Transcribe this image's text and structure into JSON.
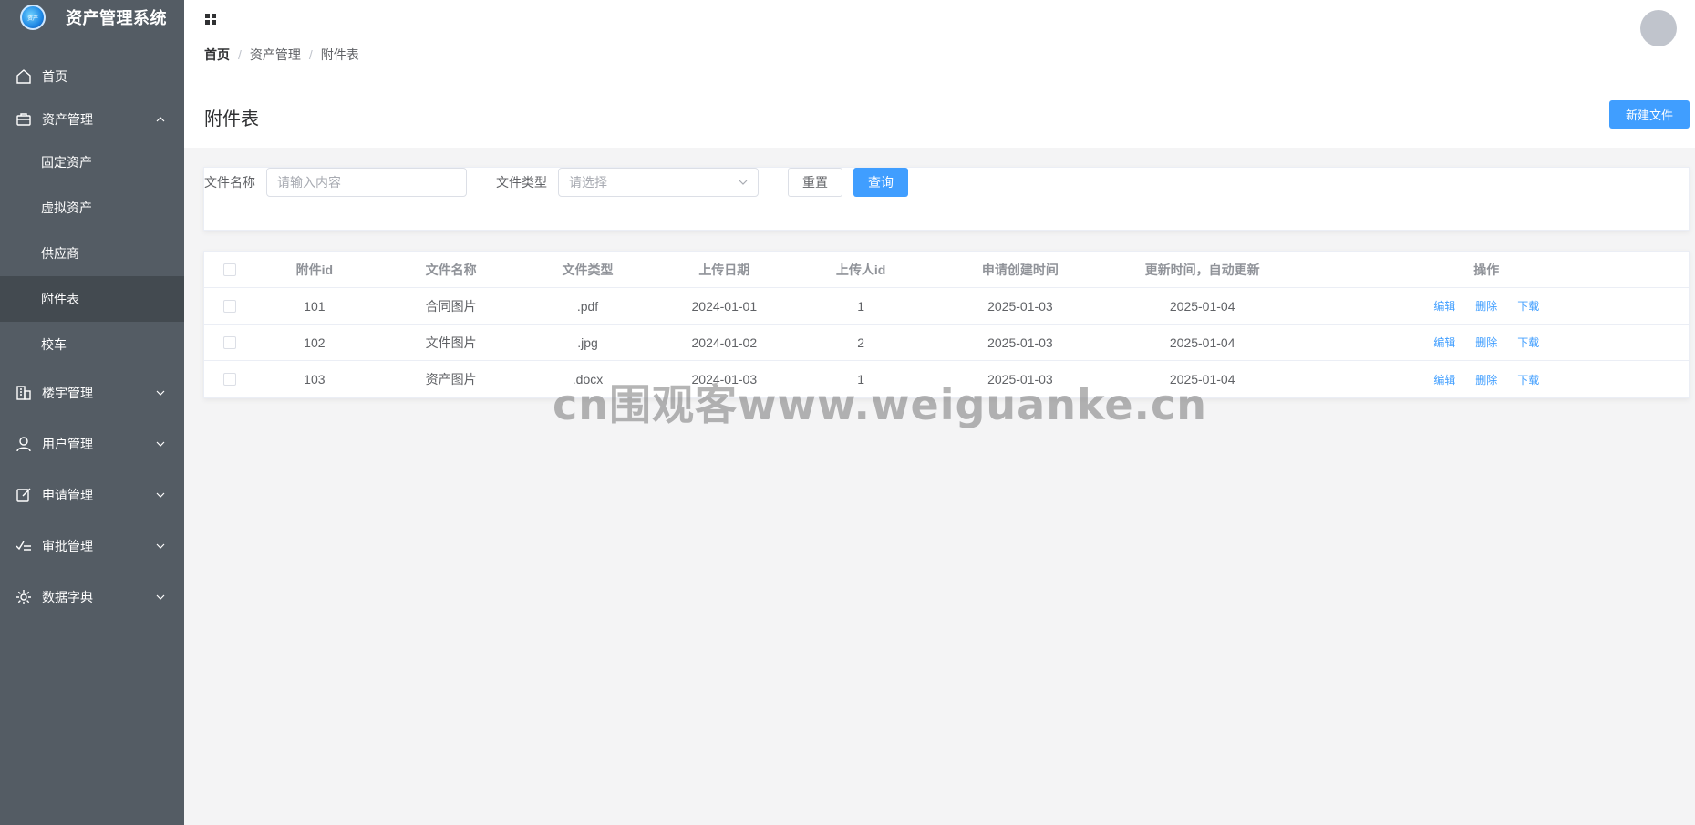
{
  "app": {
    "title": "资产管理系统",
    "logo_text": "资产"
  },
  "sidebar": {
    "items": [
      {
        "label": "首页",
        "icon": "home-icon",
        "expandable": false
      },
      {
        "label": "资产管理",
        "icon": "briefcase-icon",
        "expandable": true,
        "expanded": true,
        "children": [
          {
            "label": "固定资产",
            "active": false
          },
          {
            "label": "虚拟资产",
            "active": false
          },
          {
            "label": "供应商",
            "active": false
          },
          {
            "label": "附件表",
            "active": true
          },
          {
            "label": "校车",
            "active": false
          }
        ]
      },
      {
        "label": "楼宇管理",
        "icon": "building-icon",
        "expandable": true,
        "expanded": false
      },
      {
        "label": "用户管理",
        "icon": "user-icon",
        "expandable": true,
        "expanded": false
      },
      {
        "label": "申请管理",
        "icon": "edit-icon",
        "expandable": true,
        "expanded": false
      },
      {
        "label": "审批管理",
        "icon": "checklist-icon",
        "expandable": true,
        "expanded": false
      },
      {
        "label": "数据字典",
        "icon": "gear-icon",
        "expandable": true,
        "expanded": false
      }
    ]
  },
  "breadcrumb": [
    "首页",
    "资产管理",
    "附件表"
  ],
  "page": {
    "title": "附件表",
    "new_button": "新建文件"
  },
  "search": {
    "name_label": "文件名称",
    "name_placeholder": "请输入内容",
    "type_label": "文件类型",
    "type_placeholder": "请选择",
    "reset": "重置",
    "query": "查询"
  },
  "table": {
    "columns": [
      "附件id",
      "文件名称",
      "文件类型",
      "上传日期",
      "上传人id",
      "申请创建时间",
      "更新时间，自动更新",
      "操作"
    ],
    "rows": [
      {
        "id": "101",
        "name": "合同图片",
        "type": ".pdf",
        "date": "2024-01-01",
        "uploader": "1",
        "created": "2025-01-03",
        "updated": "2025-01-04"
      },
      {
        "id": "102",
        "name": "文件图片",
        "type": ".jpg",
        "date": "2024-01-02",
        "uploader": "2",
        "created": "2025-01-03",
        "updated": "2025-01-04"
      },
      {
        "id": "103",
        "name": "资产图片",
        "type": ".docx",
        "date": "2024-01-03",
        "uploader": "1",
        "created": "2025-01-03",
        "updated": "2025-01-04"
      }
    ],
    "ops": [
      "编辑",
      "删除",
      "下载"
    ]
  },
  "watermark": "cn围观客www.weiguanke.cn",
  "colors": {
    "sidebar_bg": "#545c64",
    "sidebar_active": "#434a50",
    "primary": "#409eff",
    "avatar": "#c0c4cc"
  }
}
